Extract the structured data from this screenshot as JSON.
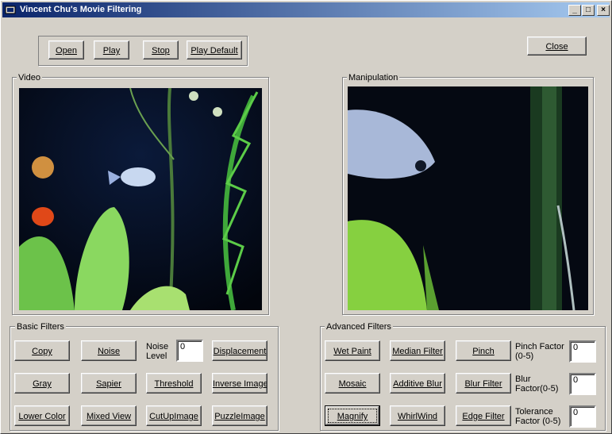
{
  "window": {
    "title": "Vincent Chu's Movie Filtering"
  },
  "titlebar_buttons": {
    "minimize": "_",
    "maximize": "□",
    "close": "×"
  },
  "toolbar": {
    "open": "Open",
    "play": "Play",
    "stop": "Stop",
    "play_default": "Play Default",
    "close": "Close"
  },
  "video": {
    "label": "Video"
  },
  "manipulation": {
    "label": "Manipulation"
  },
  "basic_filters": {
    "label": "Basic Filters",
    "copy": "Copy",
    "noise": "Noise",
    "noise_level_label": "Noise Level",
    "noise_level_value": "0",
    "displacement": "Displacement",
    "gray": "Gray",
    "sapier": "Sapier",
    "threshold": "Threshold",
    "inverse_image": "Inverse Image",
    "lower_color": "Lower Color",
    "mixed_view": "Mixed View",
    "cut_up_image": "CutUpImage",
    "puzzle_image": "PuzzleImage"
  },
  "advanced_filters": {
    "label": "Advanced Filters",
    "wet_paint": "Wet Paint",
    "median_filter": "Median Filter",
    "pinch": "Pinch",
    "pinch_factor_label": "Pinch Factor (0-5)",
    "pinch_factor_value": "0",
    "mosaic": "Mosaic",
    "additive_blur": "Additive Blur",
    "blur_filter": "Blur Filter",
    "blur_factor_label": "Blur Factor(0-5)",
    "blur_factor_value": "0",
    "magnify": "Magnify",
    "whirlwind": "WhirlWind",
    "edge_filter": "Edge Filter",
    "tolerance_factor_label": "Tolerance Factor (0-5)",
    "tolerance_factor_value": "0"
  }
}
